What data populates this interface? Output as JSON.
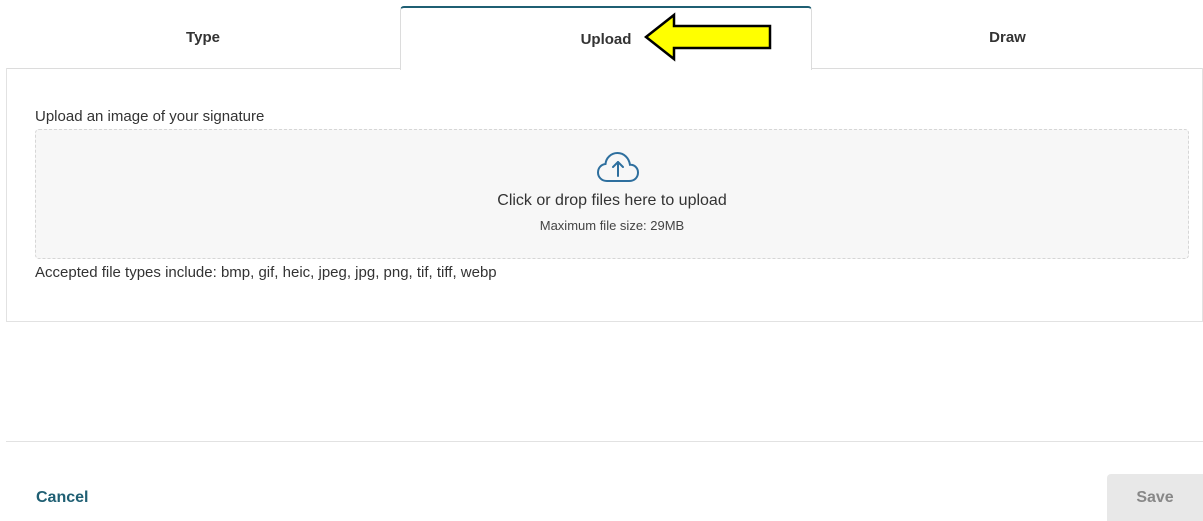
{
  "tabs": [
    {
      "label": "Type",
      "active": false
    },
    {
      "label": "Upload",
      "active": true
    },
    {
      "label": "Draw",
      "active": false
    }
  ],
  "annotation": {
    "icon": "arrow-left-icon",
    "color": "#ffff00"
  },
  "upload": {
    "label": "Upload an image of your signature",
    "icon": "cloud-upload-icon",
    "drop_text": "Click or drop files here to upload",
    "max_size": "Maximum file size: 29MB",
    "accepted_types": "Accepted file types include: bmp, gif, heic, jpeg, jpg, png, tif, tiff, webp"
  },
  "footer": {
    "cancel_label": "Cancel",
    "save_label": "Save"
  },
  "colors": {
    "accent": "#1f5f73",
    "dropzone_bg": "#f7f7f7",
    "save_disabled_bg": "#e8e8e8"
  }
}
